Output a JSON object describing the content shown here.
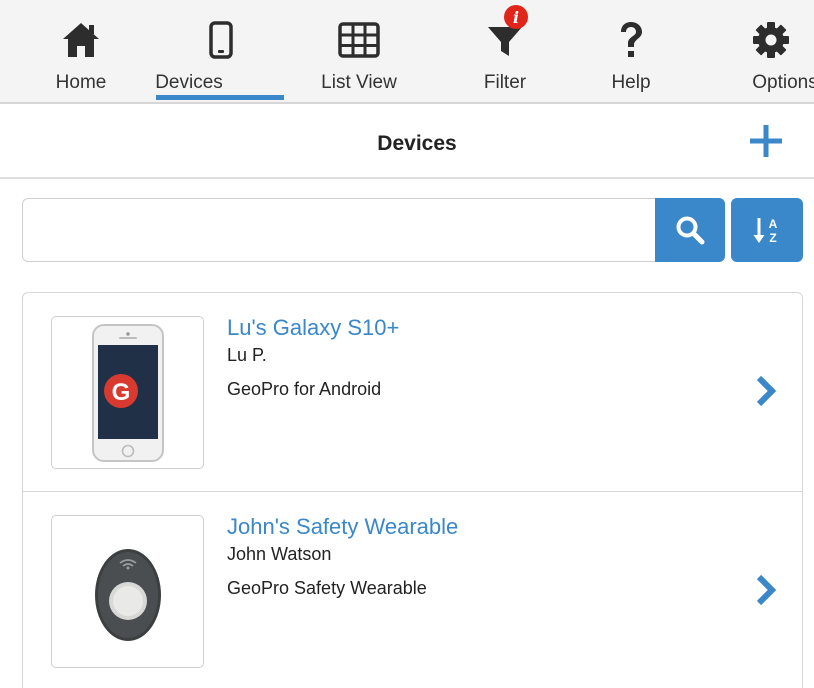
{
  "nav": {
    "items": [
      {
        "label": "Home",
        "icon": "home-icon"
      },
      {
        "label": "Devices",
        "icon": "phone-icon",
        "active": true
      },
      {
        "label": "List View",
        "icon": "grid-icon"
      },
      {
        "label": "Filter",
        "icon": "filter-icon",
        "badge": "i"
      },
      {
        "label": "Help",
        "icon": "question-icon"
      },
      {
        "label": "Options",
        "icon": "gear-icon"
      }
    ]
  },
  "header": {
    "title": "Devices",
    "add_icon": "plus-icon"
  },
  "search": {
    "value": "",
    "placeholder": "",
    "search_icon": "search-icon",
    "sort_icon": "sort-az-icon",
    "sort_letters": {
      "top": "A",
      "bottom": "Z"
    }
  },
  "devices": [
    {
      "name": "Lu's Galaxy S10+",
      "owner": "Lu P.",
      "type": "GeoPro for Android",
      "thumbnail": "phone-thumbnail",
      "logo_letter": "G"
    },
    {
      "name": "John's Safety Wearable",
      "owner": "John Watson",
      "type": "GeoPro Safety Wearable",
      "thumbnail": "wearable-thumbnail"
    }
  ],
  "colors": {
    "accent": "#3a87c9",
    "badge": "#e0251b",
    "icon_dark": "#2d2d2d",
    "nav_bg": "#f4f4f4"
  }
}
